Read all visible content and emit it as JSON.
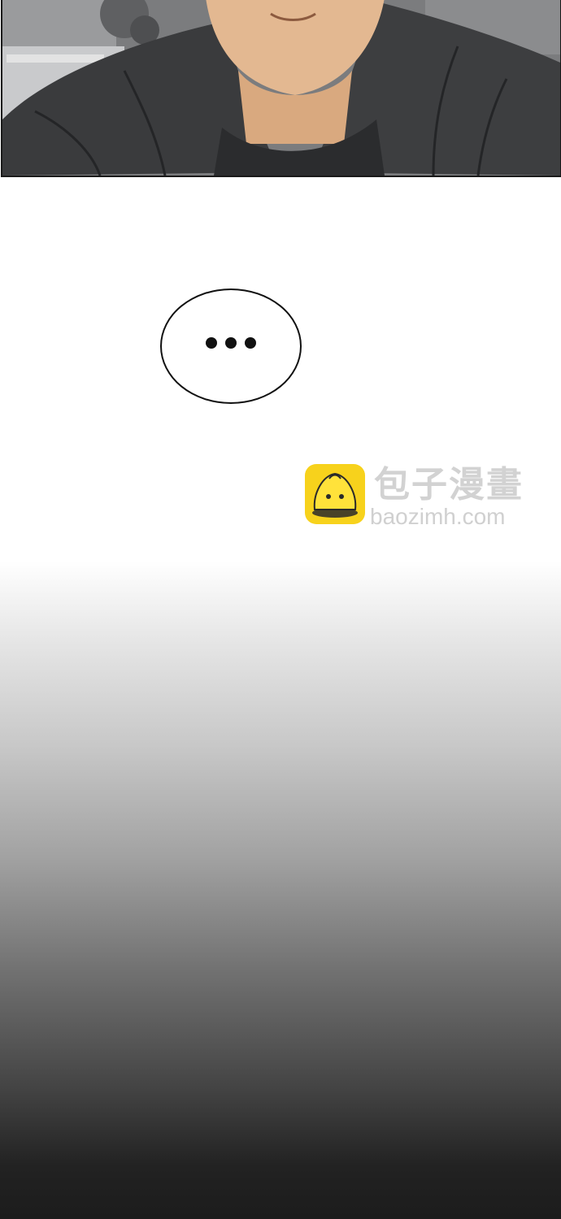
{
  "panel": {
    "description_name": "comic-panel-top"
  },
  "speech_bubble": {
    "text": "..."
  },
  "watermark": {
    "title": "包子漫畫",
    "url": "baozimh.com",
    "logo_icon": "bun-mascot-icon",
    "colors": {
      "logo_bg": "#f7d21c",
      "text": "#d2d2d2"
    }
  }
}
